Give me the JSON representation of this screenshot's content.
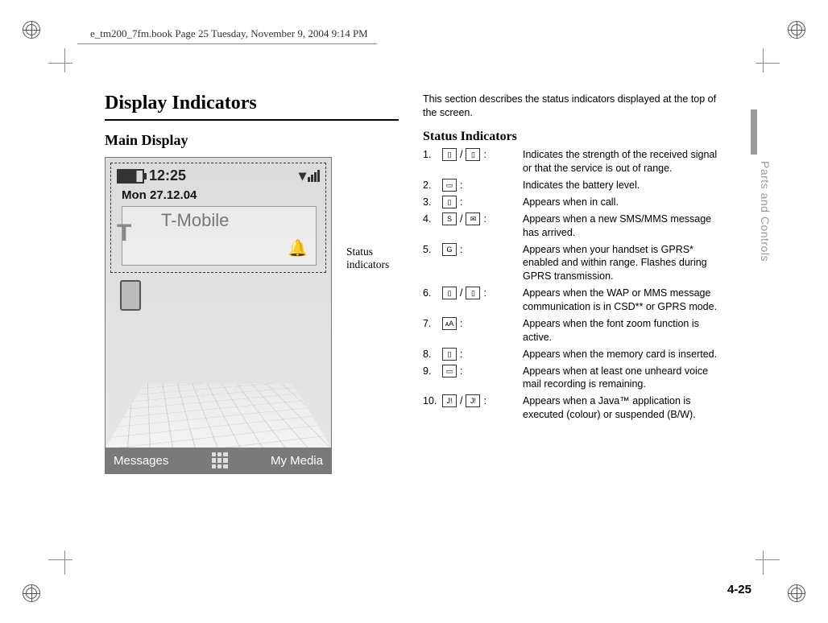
{
  "header_line": "e_tm200_7fm.book  Page 25  Tuesday, November 9, 2004  9:14 PM",
  "title": "Display Indicators",
  "subtitle": "Main Display",
  "callout": "Status indicators",
  "phone": {
    "clock": "12:25",
    "date": "Mon 27.12.04",
    "carrier": "T-Mobile",
    "soft_left": "Messages",
    "soft_right": "My Media"
  },
  "intro": "This section describes the status indicators displayed at the top of the screen.",
  "status_heading": "Status Indicators",
  "indicators": [
    {
      "num": "1.",
      "icon_label": "signal / no-signal",
      "glyph": "▯ / ▯",
      "desc": "Indicates the strength of the received signal or that the service is out of range."
    },
    {
      "num": "2.",
      "icon_label": "battery",
      "glyph": "▭",
      "desc": "Indicates the battery level."
    },
    {
      "num": "3.",
      "icon_label": "in-call",
      "glyph": "▯",
      "desc": "Appears when in call."
    },
    {
      "num": "4.",
      "icon_label": "sms-mms",
      "glyph": "S / ✉",
      "desc": "Appears when a new SMS/MMS message has arrived."
    },
    {
      "num": "5.",
      "icon_label": "gprs",
      "glyph": "G",
      "desc": "Appears when your handset is GPRS* enabled and within range. Flashes during GPRS transmission."
    },
    {
      "num": "6.",
      "icon_label": "wap-mms-mode",
      "glyph": "▯ / ▯",
      "desc": "Appears when the WAP or MMS message communication is in CSD** or GPRS mode."
    },
    {
      "num": "7.",
      "icon_label": "font-zoom",
      "glyph": "ᴀA",
      "desc": "Appears when the font zoom function is active."
    },
    {
      "num": "8.",
      "icon_label": "memory-card",
      "glyph": "▯",
      "desc": "Appears when the memory card is inserted."
    },
    {
      "num": "9.",
      "icon_label": "voicemail",
      "glyph": "▭",
      "desc": "Appears when at least one unheard voice mail recording is remaining."
    },
    {
      "num": "10.",
      "icon_label": "java",
      "glyph": "J! / J!",
      "desc": "Appears when a Java™ application is executed (colour) or suspended (B/W)."
    }
  ],
  "side_tab": "Parts and Controls",
  "page_number": "4-25"
}
